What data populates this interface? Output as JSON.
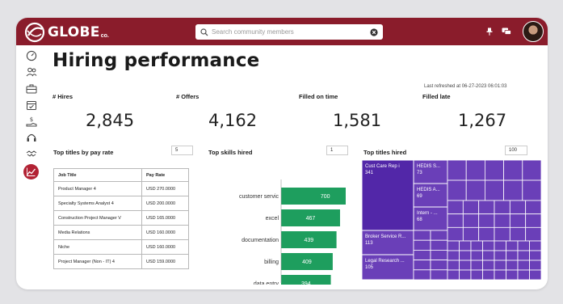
{
  "brand": {
    "name": "GLOBE",
    "suffix": "co."
  },
  "search": {
    "placeholder": "Search community members"
  },
  "icons": {
    "brand": "globe-logo-icon",
    "search": "search-icon",
    "clear": "clear-search-icon",
    "pin": "pin-icon",
    "chat": "chat-icon",
    "nav": [
      "dashboard-icon",
      "people-icon",
      "briefcase-icon",
      "calendar-icon",
      "money-hand-icon",
      "headset-icon",
      "handshake-icon",
      "chart-line-icon"
    ]
  },
  "colors": {
    "header": "#8a1c2b",
    "accent": "#b22234",
    "bar": "#1e9e5e",
    "treemap": "#6a3fb8",
    "treemap_dark": "#5227a8"
  },
  "page": {
    "title": "Hiring performance",
    "last_refreshed": "Last refreshed at 06-27-2023 06:01:03"
  },
  "kpis": [
    {
      "label": "# Hires",
      "value": "2,845"
    },
    {
      "label": "# Offers",
      "value": "4,162"
    },
    {
      "label": "Filled on time",
      "value": "1,581"
    },
    {
      "label": "Filled late",
      "value": "1,267"
    }
  ],
  "pay_table": {
    "title": "Top titles by pay rate",
    "count": "5",
    "columns": [
      "Job Title",
      "Pay Rate"
    ],
    "rows": [
      [
        "Product Manager 4",
        "USD 270.0000"
      ],
      [
        "Specialty Systems Analyst 4",
        "USD 200.0000"
      ],
      [
        "Construction Project Manager V",
        "USD 165.0000"
      ],
      [
        "Media Relations",
        "USD 160.0000"
      ],
      [
        "Niche",
        "USD 160.0000"
      ],
      [
        "Project Manager (Non - IT) 4",
        "USD 159.0000"
      ]
    ]
  },
  "skills": {
    "title": "Top skills hired",
    "count": "1",
    "chart_data": {
      "type": "bar",
      "orientation": "horizontal",
      "categories": [
        "customer servic",
        "excel",
        "documentation",
        "billing",
        "data entry"
      ],
      "values": [
        700,
        467,
        439,
        409,
        394
      ],
      "xlim": [
        0,
        800
      ]
    }
  },
  "titles": {
    "title": "Top titles hired",
    "count": "100",
    "labels": [
      {
        "name": "Cust Care Rep i",
        "value": "341"
      },
      {
        "name": "Broker Service R...",
        "value": "113"
      },
      {
        "name": "Legal Research ...",
        "value": "105"
      },
      {
        "name": "HEDIS S...",
        "value": "73"
      },
      {
        "name": "HEDIS A...",
        "value": "69"
      },
      {
        "name": "Intern - ...",
        "value": "68"
      }
    ]
  }
}
